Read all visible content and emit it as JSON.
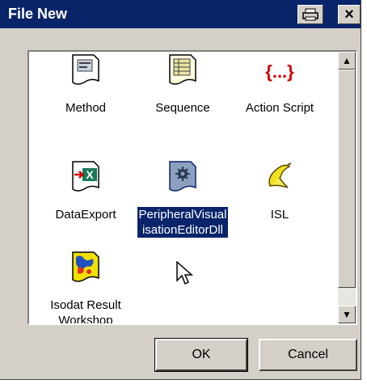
{
  "window": {
    "title": "File New"
  },
  "titlebar": {
    "print_icon": "printer-icon",
    "close_label": "×"
  },
  "items": [
    {
      "label": "Method",
      "icon": "method-document-icon"
    },
    {
      "label": "Sequence",
      "icon": "sequence-document-icon"
    },
    {
      "label": "Action Script",
      "icon": "action-script-braces-icon"
    },
    {
      "label": "DataExport",
      "icon": "data-export-icon"
    },
    {
      "label": "PeripheralVisualisationEditorDll",
      "icon": "gear-document-icon",
      "selected": true
    },
    {
      "label": "ISL",
      "icon": "banana-icon"
    },
    {
      "label": "Isodat Result Workshop",
      "icon": "isodat-result-icon"
    }
  ],
  "scrollbar": {
    "up": "▲",
    "down": "▼"
  },
  "buttons": {
    "ok": "OK",
    "cancel": "Cancel"
  },
  "colors": {
    "titlebar": "#0a246a",
    "selection": "#0a246a",
    "face": "#d4d0c8",
    "action_script_red": "#d00000"
  }
}
